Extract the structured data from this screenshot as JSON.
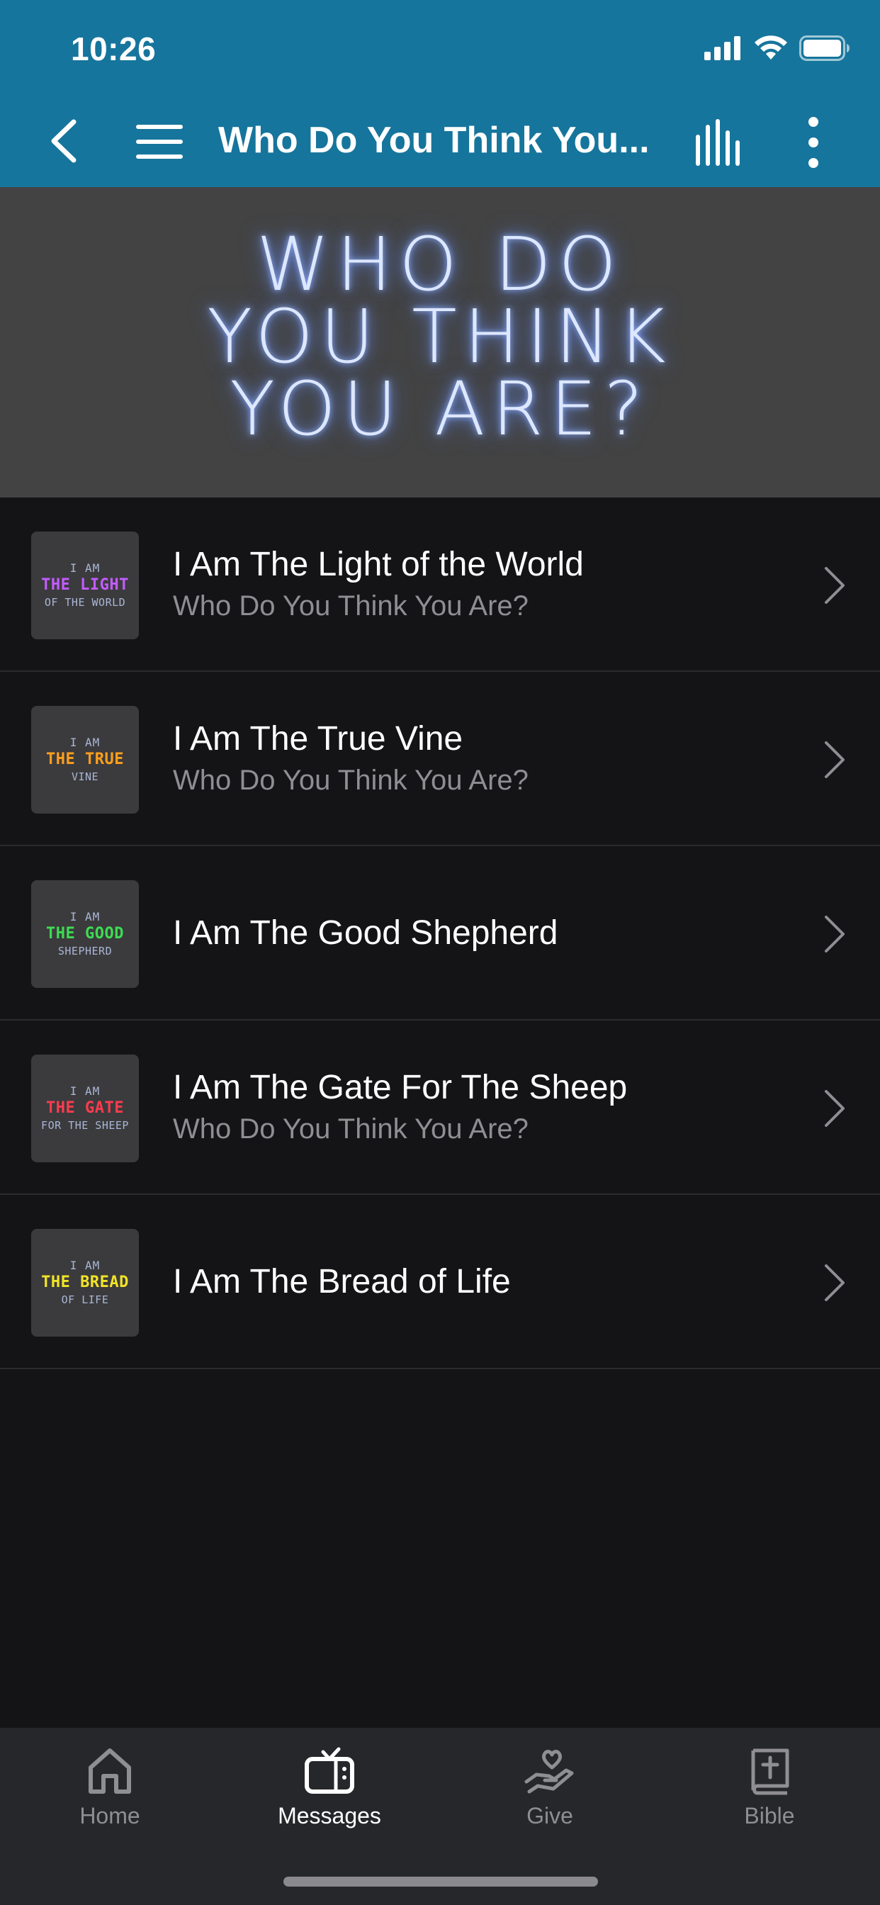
{
  "status_bar": {
    "time": "10:26"
  },
  "nav": {
    "title": "Who Do You Think You..."
  },
  "hero": {
    "title": "WHO DO\nYOU THINK\nYOU ARE?"
  },
  "items": [
    {
      "title": "I Am The Light of the World",
      "subtitle": "Who Do You Think You Are?",
      "thumb": {
        "line1": "I AM",
        "line2": "THE LIGHT",
        "line3": "OF THE WORLD",
        "accent": "#c35cff"
      }
    },
    {
      "title": "I Am The True Vine",
      "subtitle": "Who Do You Think You Are?",
      "thumb": {
        "line1": "I AM",
        "line2": "THE TRUE",
        "line3": "VINE",
        "accent": "#ff9f1c"
      }
    },
    {
      "title": "I Am The Good Shepherd",
      "subtitle": "",
      "thumb": {
        "line1": "I AM",
        "line2": "THE GOOD",
        "line3": "SHEPHERD",
        "accent": "#3ddc52"
      }
    },
    {
      "title": "I Am The Gate For The Sheep",
      "subtitle": "Who Do You Think You Are?",
      "thumb": {
        "line1": "I AM",
        "line2": "THE GATE",
        "line3": "FOR THE SHEEP",
        "accent": "#ff3b4e"
      }
    },
    {
      "title": "I Am The Bread of Life",
      "subtitle": "",
      "thumb": {
        "line1": "I AM",
        "line2": "THE BREAD",
        "line3": "OF LIFE",
        "accent": "#f2e427"
      }
    }
  ],
  "tabs": [
    {
      "label": "Home",
      "icon": "home-icon",
      "active": false
    },
    {
      "label": "Messages",
      "icon": "tv-icon",
      "active": true
    },
    {
      "label": "Give",
      "icon": "give-heart-hand-icon",
      "active": false
    },
    {
      "label": "Bible",
      "icon": "bible-icon",
      "active": false
    }
  ],
  "colors": {
    "header": "#16759c",
    "background": "#141416",
    "tabbar": "#26272a",
    "hero": "#434343"
  }
}
